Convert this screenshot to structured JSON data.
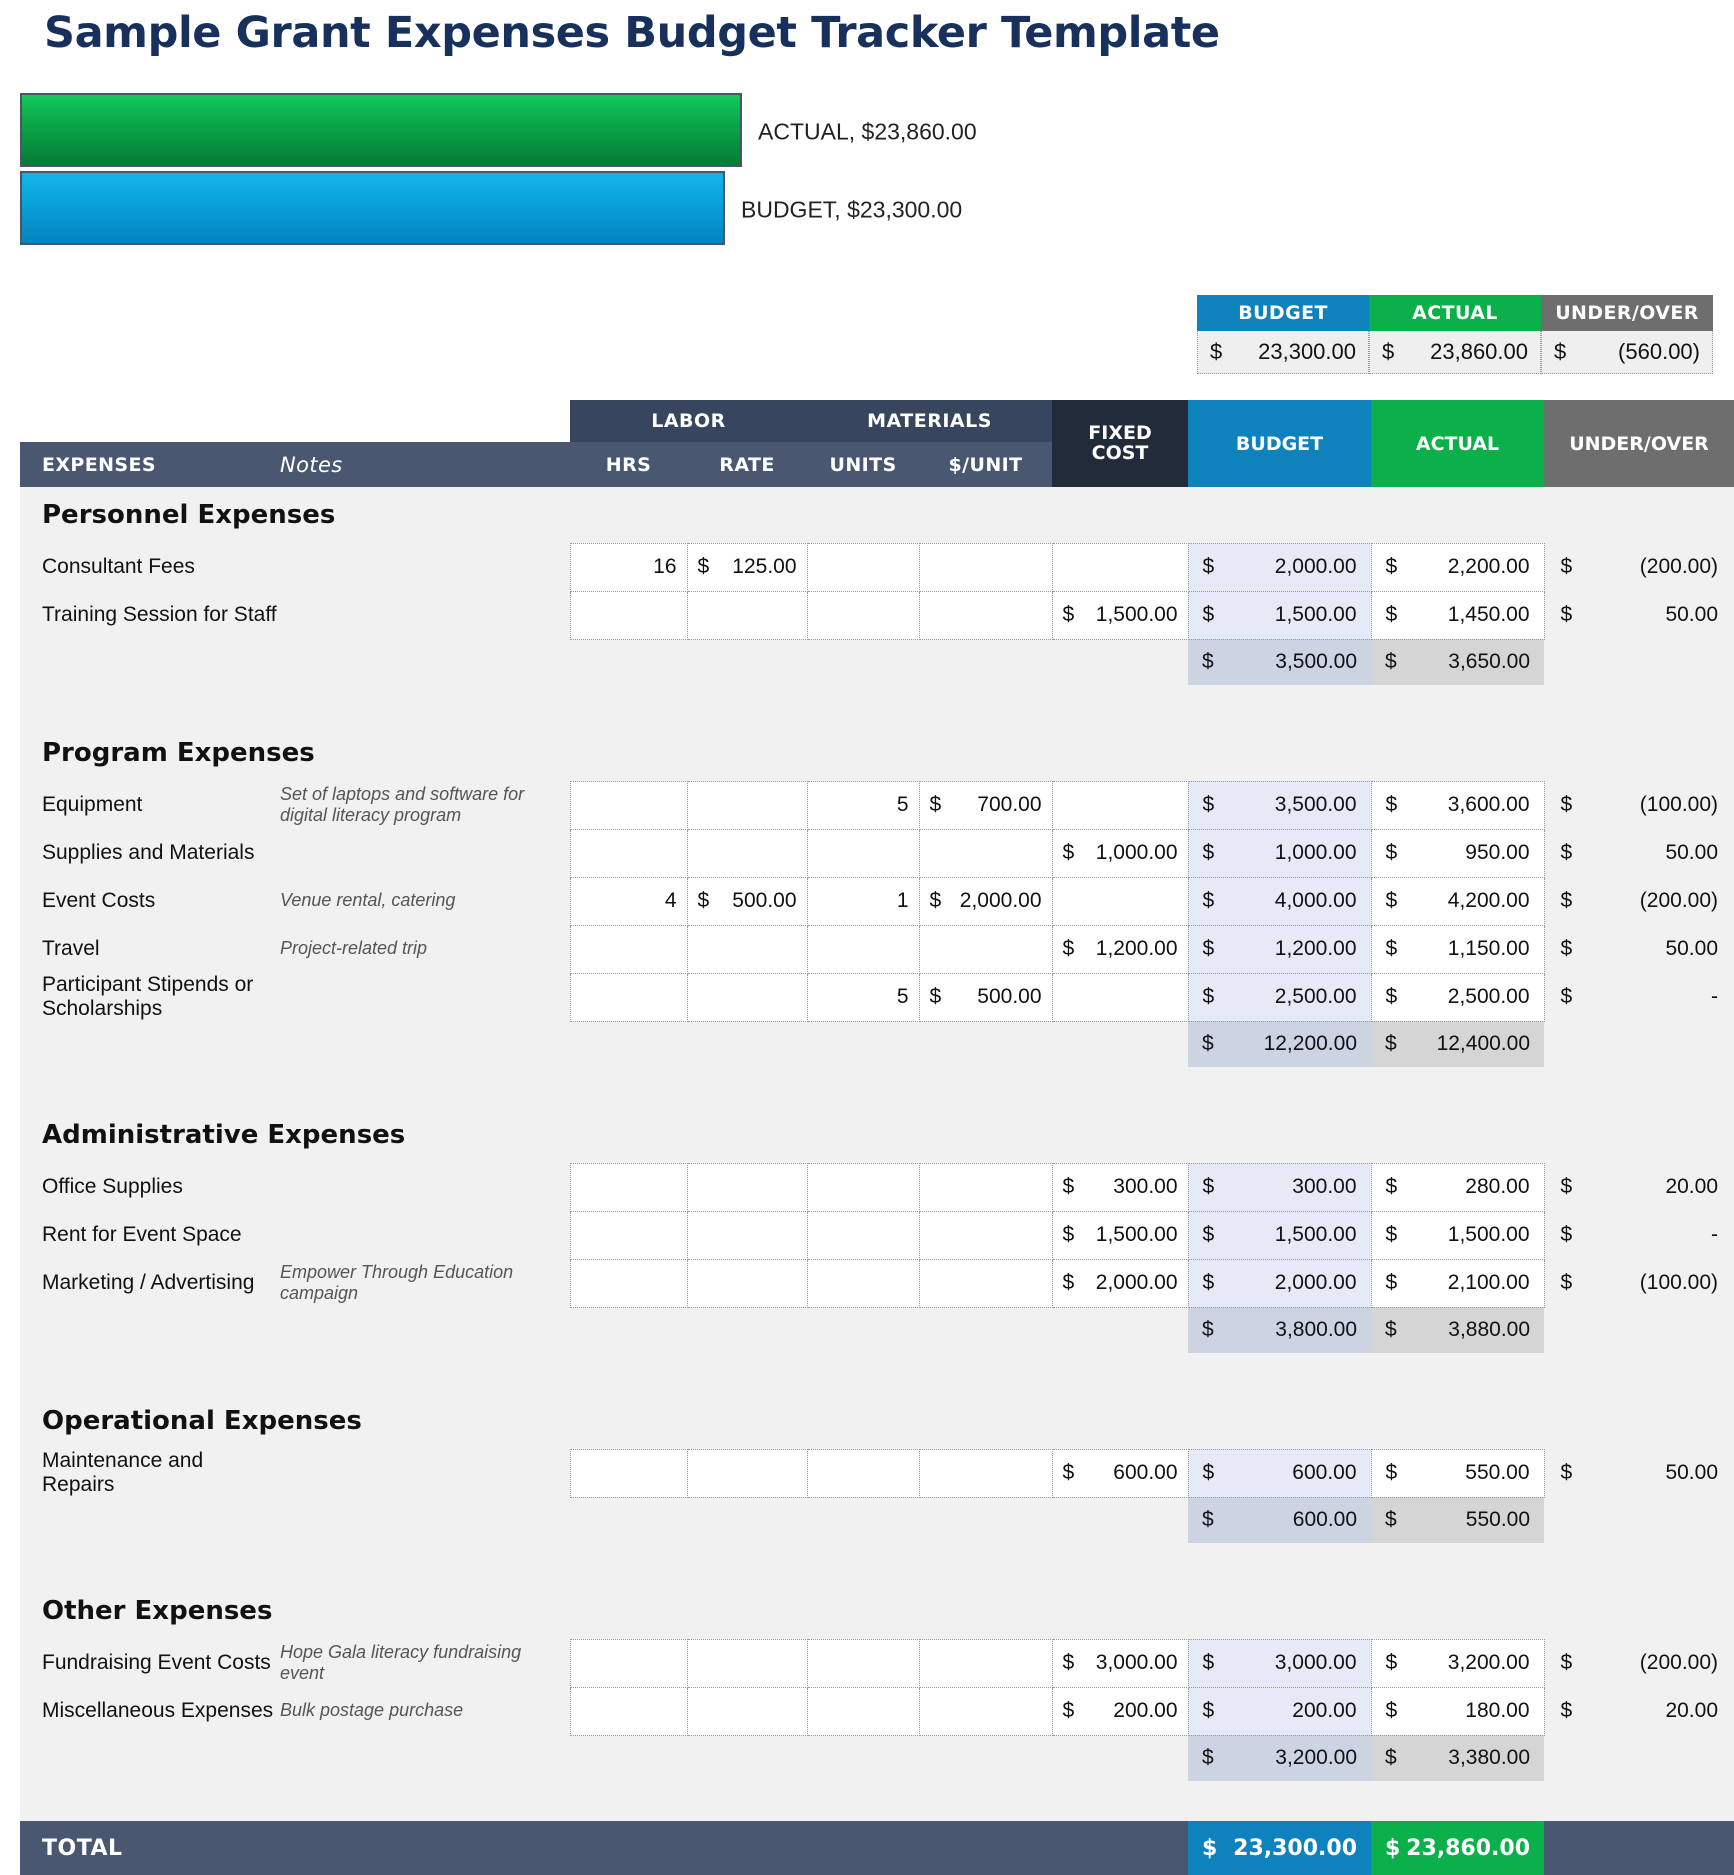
{
  "page_title": "Sample Grant Expenses Budget Tracker Template",
  "chart_data": {
    "type": "bar",
    "orientation": "horizontal",
    "title": "",
    "categories": [
      "ACTUAL",
      "BUDGET"
    ],
    "values": [
      23860.0,
      23300.0
    ],
    "labels": [
      "ACTUAL,  $23,860.00",
      "BUDGET,  $23,300.00"
    ],
    "colors": [
      "#0aa84a",
      "#0aa3dc"
    ],
    "xlabel": "",
    "ylabel": "",
    "grid": false,
    "legend": "none",
    "xlim": [
      0,
      23860
    ]
  },
  "summary": {
    "headers": {
      "budget": "BUDGET",
      "actual": "ACTUAL",
      "under_over": "UNDER/OVER"
    },
    "currency": "$",
    "budget": "23,300.00",
    "actual": "23,860.00",
    "under_over": "(560.00)"
  },
  "table_header": {
    "labor": "LABOR",
    "materials": "MATERIALS",
    "fixed_cost_line1": "FIXED",
    "fixed_cost_line2": "COST",
    "expenses": "EXPENSES",
    "notes": "Notes",
    "hrs": "HRS",
    "rate": "RATE",
    "units": "UNITS",
    "per_unit": "$/UNIT",
    "budget": "BUDGET",
    "actual": "ACTUAL",
    "under_over": "UNDER/OVER"
  },
  "currency": "$",
  "sections": [
    {
      "title": "Personnel Expenses",
      "rows": [
        {
          "label": "Consultant Fees",
          "note": "",
          "hrs": "16",
          "rate": "125.00",
          "units": "",
          "per_unit": "",
          "fixed": "",
          "budget": "2,000.00",
          "actual": "2,200.00",
          "under_over": "(200.00)"
        },
        {
          "label": "Training Session for Staff",
          "note": "",
          "hrs": "",
          "rate": "",
          "units": "",
          "per_unit": "",
          "fixed": "1,500.00",
          "budget": "1,500.00",
          "actual": "1,450.00",
          "under_over": "50.00"
        }
      ],
      "subtotal": {
        "budget": "3,500.00",
        "actual": "3,650.00"
      }
    },
    {
      "title": "Program Expenses",
      "rows": [
        {
          "label": "Equipment",
          "note": "Set of laptops and software for digital literacy program",
          "hrs": "",
          "rate": "",
          "units": "5",
          "per_unit": "700.00",
          "fixed": "",
          "budget": "3,500.00",
          "actual": "3,600.00",
          "under_over": "(100.00)"
        },
        {
          "label": "Supplies and Materials",
          "note": "",
          "hrs": "",
          "rate": "",
          "units": "",
          "per_unit": "",
          "fixed": "1,000.00",
          "budget": "1,000.00",
          "actual": "950.00",
          "under_over": "50.00"
        },
        {
          "label": "Event Costs",
          "note": "Venue rental, catering",
          "hrs": "4",
          "rate": "500.00",
          "units": "1",
          "per_unit": "2,000.00",
          "fixed": "",
          "budget": "4,000.00",
          "actual": "4,200.00",
          "under_over": "(200.00)"
        },
        {
          "label": "Travel",
          "note": "Project-related trip",
          "hrs": "",
          "rate": "",
          "units": "",
          "per_unit": "",
          "fixed": "1,200.00",
          "budget": "1,200.00",
          "actual": "1,150.00",
          "under_over": "50.00"
        },
        {
          "label": "Participant Stipends or Scholarships",
          "note": "",
          "hrs": "",
          "rate": "",
          "units": "5",
          "per_unit": "500.00",
          "fixed": "",
          "budget": "2,500.00",
          "actual": "2,500.00",
          "under_over": "-"
        }
      ],
      "subtotal": {
        "budget": "12,200.00",
        "actual": "12,400.00"
      }
    },
    {
      "title": "Administrative Expenses",
      "rows": [
        {
          "label": "Office Supplies",
          "note": "",
          "hrs": "",
          "rate": "",
          "units": "",
          "per_unit": "",
          "fixed": "300.00",
          "budget": "300.00",
          "actual": "280.00",
          "under_over": "20.00"
        },
        {
          "label": "Rent for Event Space",
          "note": "",
          "hrs": "",
          "rate": "",
          "units": "",
          "per_unit": "",
          "fixed": "1,500.00",
          "budget": "1,500.00",
          "actual": "1,500.00",
          "under_over": "-"
        },
        {
          "label": "Marketing / Advertising",
          "note": "Empower Through Education campaign",
          "hrs": "",
          "rate": "",
          "units": "",
          "per_unit": "",
          "fixed": "2,000.00",
          "budget": "2,000.00",
          "actual": "2,100.00",
          "under_over": "(100.00)"
        }
      ],
      "subtotal": {
        "budget": "3,800.00",
        "actual": "3,880.00"
      }
    },
    {
      "title": "Operational Expenses",
      "rows": [
        {
          "label": "Maintenance and Repairs",
          "note": "",
          "hrs": "",
          "rate": "",
          "units": "",
          "per_unit": "",
          "fixed": "600.00",
          "budget": "600.00",
          "actual": "550.00",
          "under_over": "50.00"
        }
      ],
      "subtotal": {
        "budget": "600.00",
        "actual": "550.00"
      }
    },
    {
      "title": "Other Expenses",
      "rows": [
        {
          "label": "Fundraising Event Costs",
          "note": "Hope Gala literacy fundraising event",
          "hrs": "",
          "rate": "",
          "units": "",
          "per_unit": "",
          "fixed": "3,000.00",
          "budget": "3,000.00",
          "actual": "3,200.00",
          "under_over": "(200.00)"
        },
        {
          "label": "Miscellaneous Expenses",
          "note": "Bulk postage purchase",
          "hrs": "",
          "rate": "",
          "units": "",
          "per_unit": "",
          "fixed": "200.00",
          "budget": "200.00",
          "actual": "180.00",
          "under_over": "20.00"
        }
      ],
      "subtotal": {
        "budget": "3,200.00",
        "actual": "3,380.00"
      }
    }
  ],
  "total": {
    "label": "TOTAL",
    "budget": "23,300.00",
    "actual": "23,860.00"
  },
  "colors": {
    "budget": "#0e82bd",
    "actual": "#0cb04a",
    "under_over": "#6e6e6e",
    "header_dark": "#4a5770",
    "header_darker": "#222b3a",
    "title": "#17315c"
  }
}
